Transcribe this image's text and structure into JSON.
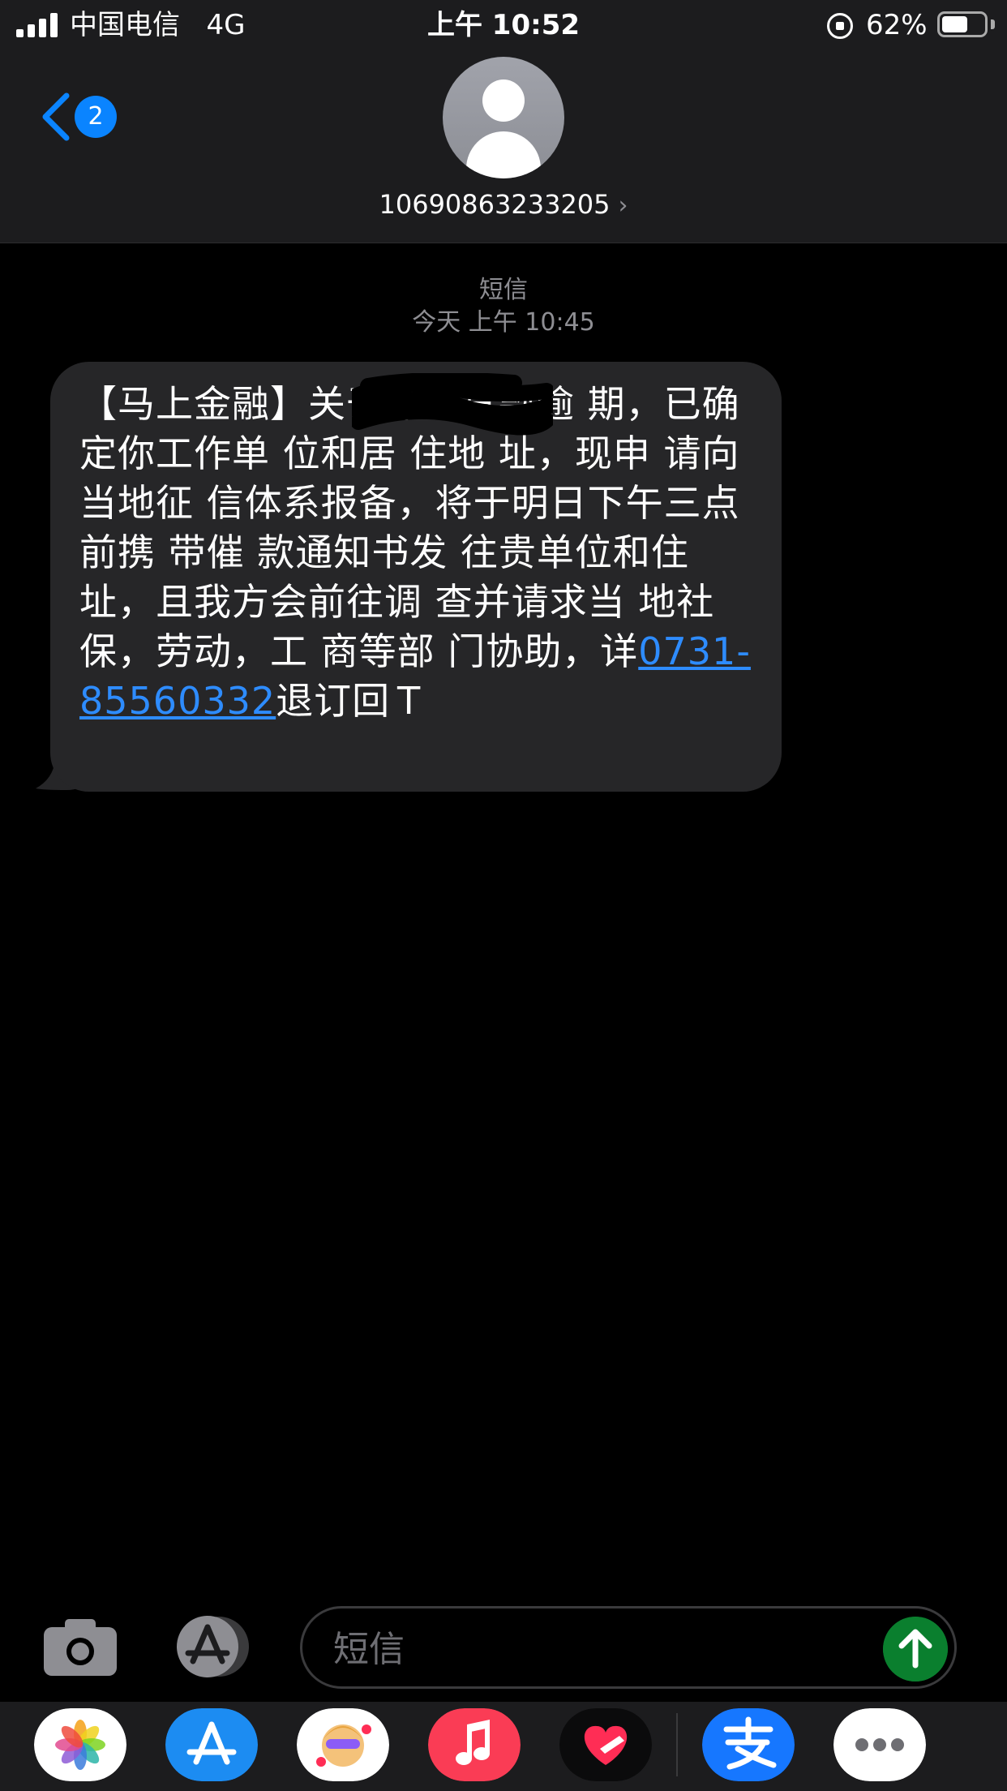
{
  "status_bar": {
    "carrier": "中国电信",
    "network": "4G",
    "time": "上午 10:52",
    "battery_percent": "62%",
    "battery_level": 0.62
  },
  "header": {
    "back_badge": "2",
    "contact": "10690863233205",
    "contact_chevron": "›"
  },
  "conversation": {
    "service": "短信",
    "timestamp": "今天 上午 10:45",
    "message": {
      "before_link": "【马上金融】关于你的贷款逾 期，已确定你工作单 位和居 住地 址，现申 请向当地征 信体系报备，将于明日下午三点前携 带催 款通知书发 往贵单位和住 址，且我方会前往调 查并请求当 地社 保，劳动，工 商等部 门协助，详",
      "link": "0731-85560332",
      "after_link": "退订回Ｔ"
    }
  },
  "input_bar": {
    "placeholder": "短信"
  },
  "icons": {
    "back": "chevron-left-icon",
    "camera": "camera-icon",
    "apps": "app-store-icon",
    "send": "arrow-up-icon"
  },
  "app_drawer": {
    "apps": [
      "photos-icon",
      "app-store-icon",
      "memoji-icon",
      "music-icon",
      "digital-touch-icon",
      "alipay-icon",
      "more-icon"
    ]
  },
  "colors": {
    "accent": "#0a84ff",
    "link": "#2e8cff",
    "bubble": "#262628",
    "send": "#0a7f2e",
    "bars": "#1c1c1e"
  }
}
